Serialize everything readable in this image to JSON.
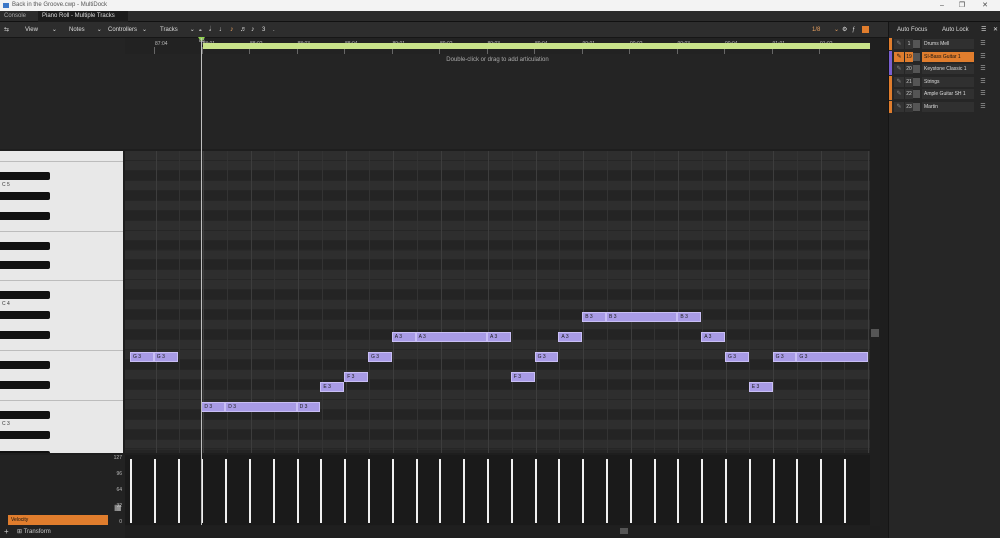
{
  "window": {
    "title": "Back in the Groove.cwp - MultiDock",
    "minimize": "–",
    "maximize": "❐",
    "close": "✕"
  },
  "tabs": [
    {
      "label": "Console"
    },
    {
      "label": "Piano Roll - Multiple Tracks"
    }
  ],
  "tab_close": "✕",
  "toolbar": {
    "view": "View",
    "notes": "Notes",
    "controllers": "Controllers",
    "tracks": "Tracks",
    "snap_value": "1/8",
    "triplet": "3",
    "dot": "."
  },
  "right_panel": {
    "auto_focus": "Auto Focus",
    "auto_lock": "Auto Lock",
    "tracks": [
      {
        "num": "1",
        "name": "Drums Mell",
        "color": "#e07d2d",
        "selected": false
      },
      {
        "num": "19",
        "name": "SI-Bass Guitar 1",
        "color": "#7a5fd0",
        "selected": true
      },
      {
        "num": "20",
        "name": "Keystone Classic 1",
        "color": "#7a5fd0",
        "selected": false
      },
      {
        "num": "21",
        "name": "Strings",
        "color": "#e07d2d",
        "selected": false
      },
      {
        "num": "22",
        "name": "Ample Guitar SH 1",
        "color": "#e07d2d",
        "selected": false
      },
      {
        "num": "23",
        "name": "Martin",
        "color": "#e07d2d",
        "selected": false
      }
    ]
  },
  "ruler": {
    "labels": [
      "87:04",
      "88:01",
      "88:02",
      "88:03",
      "88:04",
      "89:01",
      "89:02",
      "89:03",
      "89:04",
      "90:01",
      "90:02",
      "90:03",
      "90:04",
      "91:01",
      "91:02"
    ],
    "playhead_label": "88"
  },
  "articulation_hint": "Double-click or drag to add articulation",
  "keyboard": {
    "labels": [
      "C 5",
      "C 4",
      "C 3"
    ]
  },
  "notes": [
    {
      "label": "G 3",
      "pitch": "G3",
      "start": 0.0,
      "len": 1.0
    },
    {
      "label": "G 3",
      "pitch": "G3",
      "start": 1.0,
      "len": 1.0
    },
    {
      "label": "D 3",
      "pitch": "D3",
      "start": 3.0,
      "len": 1.0
    },
    {
      "label": "D 3",
      "pitch": "D3",
      "start": 4.0,
      "len": 3.0
    },
    {
      "label": "D 3",
      "pitch": "D3",
      "start": 7.0,
      "len": 1.0
    },
    {
      "label": "E 3",
      "pitch": "E3",
      "start": 8.0,
      "len": 1.0
    },
    {
      "label": "F 3",
      "pitch": "F3",
      "start": 9.0,
      "len": 1.0
    },
    {
      "label": "G 3",
      "pitch": "G3",
      "start": 10.0,
      "len": 1.0
    },
    {
      "label": "A 3",
      "pitch": "A3",
      "start": 11.0,
      "len": 1.0
    },
    {
      "label": "A 3",
      "pitch": "A3",
      "start": 12.0,
      "len": 3.0
    },
    {
      "label": "A 3",
      "pitch": "A3",
      "start": 15.0,
      "len": 1.0
    },
    {
      "label": "F 3",
      "pitch": "F3",
      "start": 16.0,
      "len": 1.0
    },
    {
      "label": "G 3",
      "pitch": "G3",
      "start": 17.0,
      "len": 1.0
    },
    {
      "label": "A 3",
      "pitch": "A3",
      "start": 18.0,
      "len": 1.0
    },
    {
      "label": "B 3",
      "pitch": "B3",
      "start": 19.0,
      "len": 1.0
    },
    {
      "label": "B 3",
      "pitch": "B3",
      "start": 20.0,
      "len": 3.0
    },
    {
      "label": "B 3",
      "pitch": "B3",
      "start": 23.0,
      "len": 1.0
    },
    {
      "label": "A 3",
      "pitch": "A3",
      "start": 24.0,
      "len": 1.0
    },
    {
      "label": "G 3",
      "pitch": "G3",
      "start": 25.0,
      "len": 1.0
    },
    {
      "label": "E 3",
      "pitch": "E3",
      "start": 26.0,
      "len": 1.0
    },
    {
      "label": "G 3",
      "pitch": "G3",
      "start": 27.0,
      "len": 1.0
    },
    {
      "label": "G 3",
      "pitch": "G3",
      "start": 28.0,
      "len": 3.0
    }
  ],
  "velocity": {
    "scale_labels": [
      "127",
      "96",
      "64",
      "32",
      "0"
    ],
    "values": [
      127,
      127,
      127,
      127,
      127,
      127,
      127,
      127,
      127,
      127,
      127,
      127,
      127,
      127,
      127,
      127,
      127,
      127,
      127,
      127,
      127,
      127,
      127,
      127,
      127,
      127,
      127,
      127,
      127,
      127,
      127
    ],
    "lane_button": "Velocity"
  },
  "transform_label": "Transform"
}
